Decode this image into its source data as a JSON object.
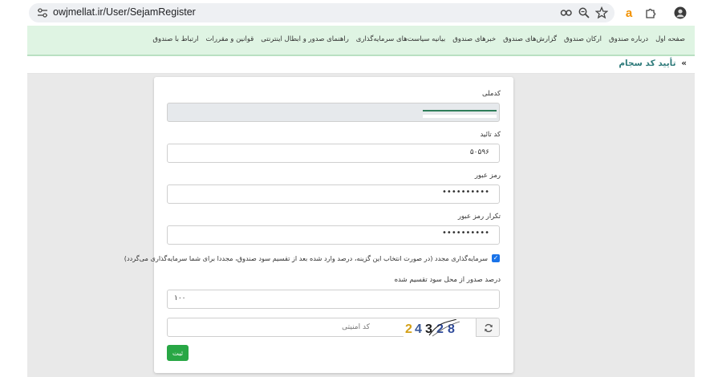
{
  "browser": {
    "url": "owjmellat.ir/User/SejamRegister",
    "icons": [
      "tune-icon",
      "key-icon",
      "zoom-icon",
      "bookmark-star-icon",
      "extension-a-icon",
      "puzzle-icon",
      "profile-avatar"
    ]
  },
  "nav": {
    "items": [
      "صفحه اول",
      "درباره صندوق",
      "ارکان صندوق",
      "گزارش‌های صندوق",
      "خبرهای صندوق",
      "بیانیه سیاست‌های سرمایه‌گذاری",
      "راهنمای صدور و ابطال اینترنتی",
      "قوانین و مقررات",
      "ارتباط با صندوق"
    ]
  },
  "breadcrumb": {
    "chevron": "»",
    "title": "تأیید کد سجام"
  },
  "form": {
    "national_code_label": "کدملی",
    "confirm_code_label": "کد تائید",
    "confirm_code_value": "۵۰۵۹۶",
    "password_label": "رمز عبور",
    "password_value": "••••••••••",
    "password_repeat_label": "تکرار رمز عبور",
    "password_repeat_value": "••••••••••",
    "reinvest_checked": true,
    "reinvest_text": "سرمایه‌گذاری مجدد (در صورت انتخاب این گزینه، درصد وارد شده بعد از تقسیم سود صندوق، مجددا برای شما سرمایه‌گذاری می‌گردد)",
    "percent_label": "درصد صدور از محل سود تقسیم شده",
    "percent_value": "۱۰۰",
    "captcha_placeholder": "کد امنیتی",
    "captcha_digits": "24328",
    "submit_label": "ثبت"
  },
  "colors": {
    "nav_bg": "#dff4e3",
    "breadcrumb_title": "#2e7a7a",
    "submit_bg": "#28a745",
    "checkbox": "#1a73e8"
  }
}
